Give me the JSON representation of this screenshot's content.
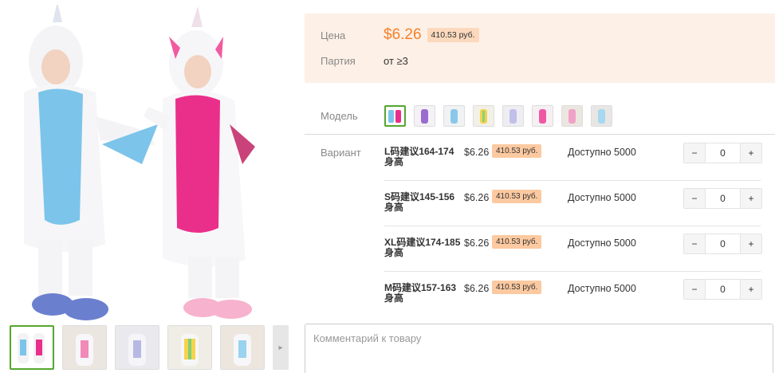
{
  "product": {
    "photo_alt": "unicorn-kigurumi-photo",
    "thumbnails": [
      "thumb-1",
      "thumb-2",
      "thumb-3",
      "thumb-4",
      "thumb-5"
    ],
    "next_icon": "chevron-right-icon"
  },
  "pricing": {
    "price_label": "Цена",
    "price_value": "$6.26",
    "price_rub": "410.53 руб.",
    "batch_label": "Партия",
    "batch_value": "от ≥3"
  },
  "model": {
    "label": "Модель",
    "swatches": [
      "model-1",
      "model-2",
      "model-3",
      "model-4",
      "model-5",
      "model-6",
      "model-7",
      "model-8"
    ]
  },
  "variants": {
    "label": "Вариант",
    "items": [
      {
        "name": "L码建议164-174身高",
        "price": "$6.26",
        "rub": "410.53 руб.",
        "avail": "Доступно 5000",
        "qty": "0"
      },
      {
        "name": "S码建议145-156身高",
        "price": "$6.26",
        "rub": "410.53 руб.",
        "avail": "Доступно 5000",
        "qty": "0"
      },
      {
        "name": "XL码建议174-185身高",
        "price": "$6.26",
        "rub": "410.53 руб.",
        "avail": "Доступно 5000",
        "qty": "0"
      },
      {
        "name": "M码建议157-163身高",
        "price": "$6.26",
        "rub": "410.53 руб.",
        "avail": "Доступно 5000",
        "qty": "0"
      }
    ],
    "minus": "−",
    "plus": "+"
  },
  "comment": {
    "placeholder": "Комментарий к товару"
  }
}
